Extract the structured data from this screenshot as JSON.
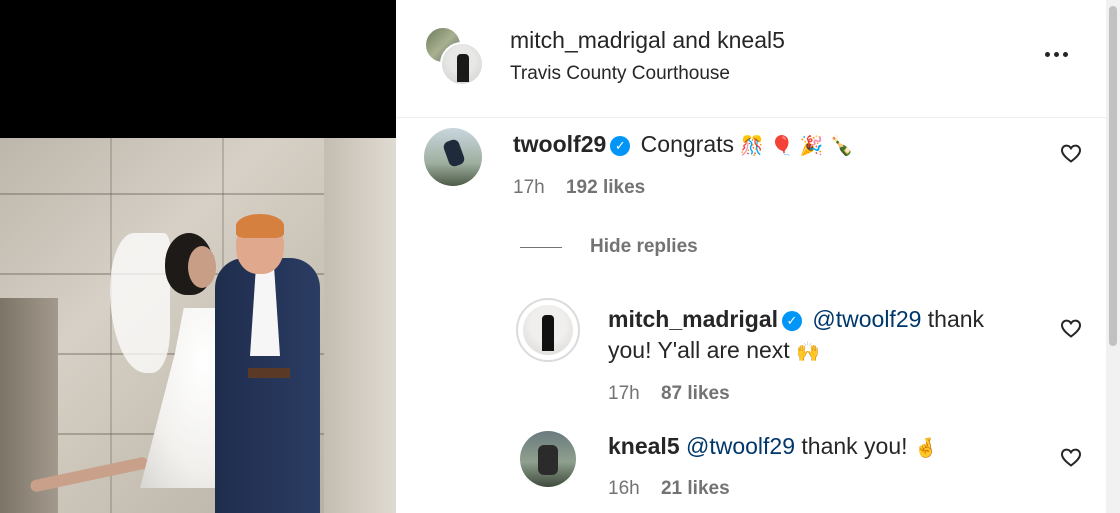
{
  "post": {
    "author_primary": "mitch_madrigal",
    "author_conjunction": "and",
    "author_secondary": "kneal5",
    "location": "Travis County Courthouse"
  },
  "comments": [
    {
      "username": "twoolf29",
      "verified": true,
      "text": "Congrats",
      "emojis": "🎊 🎈 🎉 🍾",
      "time": "17h",
      "likes": "192 likes"
    }
  ],
  "replies_toggle": {
    "label": "Hide replies"
  },
  "replies": [
    {
      "username": "mitch_madrigal",
      "verified": true,
      "mention": "@twoolf29",
      "text_line1": "thank",
      "text_line2": "you! Y'all are next",
      "emoji": "🙌",
      "time": "17h",
      "likes": "87 likes"
    },
    {
      "username": "kneal5",
      "verified": false,
      "mention": "@twoolf29",
      "text": "thank you!",
      "emoji": "🤞",
      "time": "16h",
      "likes": "21 likes"
    }
  ],
  "colors": {
    "verified": "#0095f6",
    "mention": "#00376b",
    "meta": "#737373"
  }
}
